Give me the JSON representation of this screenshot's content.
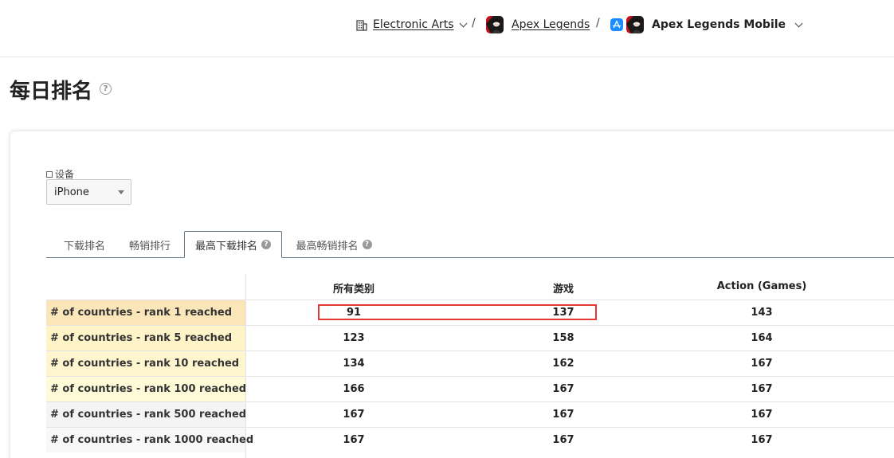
{
  "breadcrumb": {
    "company": "Electronic Arts",
    "app": "Apex Legends",
    "mobile_app": "Apex Legends Mobile",
    "separator": "/"
  },
  "page": {
    "title": "每日排名",
    "help": "?"
  },
  "device": {
    "label": "设备",
    "selected": "iPhone"
  },
  "tabs": [
    {
      "label": "下载排名",
      "active": false,
      "has_help": false
    },
    {
      "label": "畅销排行",
      "active": false,
      "has_help": false
    },
    {
      "label": "最高下载排名",
      "active": true,
      "has_help": true
    },
    {
      "label": "最高畅销排名",
      "active": false,
      "has_help": true
    }
  ],
  "table": {
    "columns": [
      "所有类别",
      "游戏",
      "Action (Games)"
    ],
    "rows": [
      {
        "label": "# of countries - rank 1 reached",
        "values": [
          "91",
          "137",
          "143"
        ]
      },
      {
        "label": "# of countries - rank 5 reached",
        "values": [
          "123",
          "158",
          "164"
        ]
      },
      {
        "label": "# of countries - rank 10 reached",
        "values": [
          "134",
          "162",
          "167"
        ]
      },
      {
        "label": "# of countries - rank 100 reached",
        "values": [
          "166",
          "167",
          "167"
        ]
      },
      {
        "label": "# of countries - rank 500 reached",
        "values": [
          "167",
          "167",
          "167"
        ]
      },
      {
        "label": "# of countries - rank 1000 reached",
        "values": [
          "167",
          "167",
          "167"
        ]
      }
    ]
  },
  "colors": {
    "rank1_bg": "#fbe6ba",
    "rank5_bg": "#fff3c8",
    "rank10_bg": "#fff6cf",
    "rank100_bg": "#fffad8",
    "rank500_bg": "#f4f4f4",
    "rank1000_bg": "#f8f8f8",
    "highlight": "#e53935",
    "store_blue": "#1a8cff"
  },
  "icons": {
    "company": "building-icon",
    "app": "apex-legends-app-icon",
    "store": "app-store-icon",
    "help": "question-circle-icon",
    "dropdown": "chevron-down-icon"
  }
}
